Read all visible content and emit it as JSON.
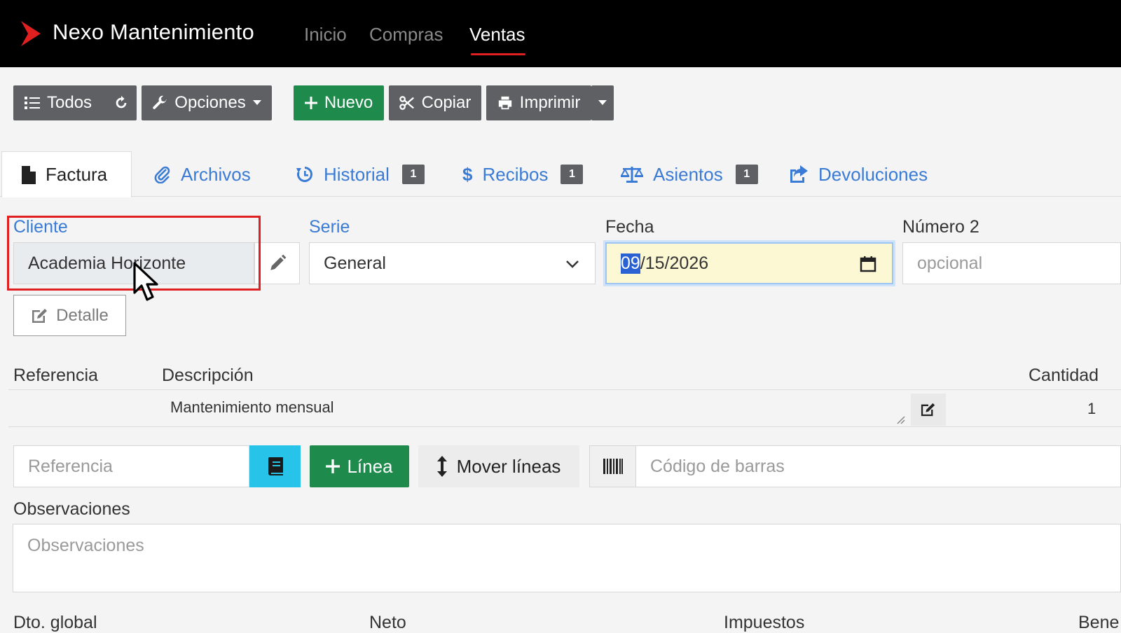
{
  "navbar": {
    "brand": "Nexo Mantenimiento",
    "items": [
      {
        "label": "Inicio"
      },
      {
        "label": "Compras"
      },
      {
        "label": "Ventas"
      }
    ],
    "accent_color": "#e02020"
  },
  "toolbar": {
    "todos": "Todos",
    "opciones": "Opciones",
    "nuevo": "Nuevo",
    "copiar": "Copiar",
    "imprimir": "Imprimir"
  },
  "tabs": [
    {
      "label": "Factura"
    },
    {
      "label": "Archivos"
    },
    {
      "label": "Historial",
      "badge": "1"
    },
    {
      "label": "Recibos",
      "badge": "1"
    },
    {
      "label": "Asientos",
      "badge": "1"
    },
    {
      "label": "Devoluciones"
    }
  ],
  "form": {
    "cliente_label": "Cliente",
    "cliente_value": "Academia Horizonte",
    "serie_label": "Serie",
    "serie_value": "General",
    "fecha_label": "Fecha",
    "fecha_month": "09",
    "fecha_rest": "/15/2026",
    "numero2_label": "Número 2",
    "numero2_placeholder": "opcional",
    "detalle": "Detalle"
  },
  "lines": {
    "headers": {
      "referencia": "Referencia",
      "descripcion": "Descripción",
      "cantidad": "Cantidad"
    },
    "rows": [
      {
        "referencia": "",
        "descripcion": "Mantenimiento mensual",
        "cantidad": "1"
      }
    ]
  },
  "line_tools": {
    "referencia_placeholder": "Referencia",
    "linea": "Línea",
    "mover_lineas": "Mover líneas",
    "barcode_placeholder": "Código de barras"
  },
  "observaciones": {
    "label": "Observaciones",
    "placeholder": "Observaciones"
  },
  "totals": {
    "dto_global": "Dto. global",
    "neto": "Neto",
    "impuestos": "Impuestos",
    "beneficio": "Bene"
  }
}
